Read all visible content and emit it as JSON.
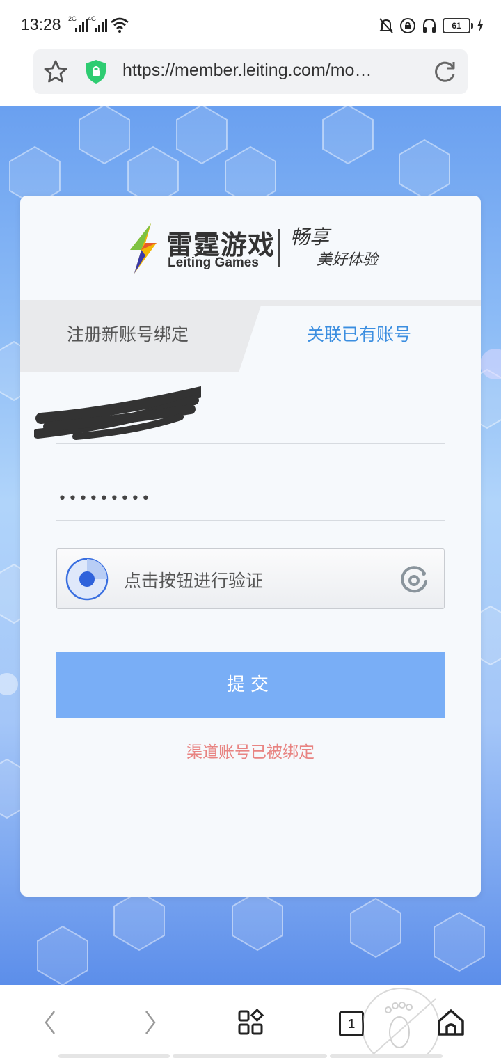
{
  "status_bar": {
    "time": "13:28",
    "signal_1_label": "2G",
    "signal_2_label": "4G",
    "battery_level": "61",
    "icons": [
      "signal-icon",
      "signal-icon",
      "wifi-icon",
      "bell-off-icon",
      "lock-rotation-icon",
      "headphones-icon",
      "battery-icon",
      "charging-icon"
    ]
  },
  "url_bar": {
    "url": "https://member.leiting.com/mo…"
  },
  "logo": {
    "brand_cn": "雷霆游戏",
    "brand_en": "Leiting Games",
    "slogan_line1": "畅享",
    "slogan_line2": "美好体验"
  },
  "tabs": [
    {
      "label": "注册新账号绑定",
      "active": false
    },
    {
      "label": "关联已有账号",
      "active": true
    }
  ],
  "form": {
    "username_value": "",
    "password_value": "•••••••••",
    "captcha_prompt": "点击按钮进行验证",
    "submit_label": "提交",
    "error_message": "渠道账号已被绑定"
  },
  "bottom_nav": {
    "tab_count": "1",
    "icons": [
      "back-icon",
      "forward-icon",
      "apps-icon",
      "tabs-icon",
      "home-icon",
      "footprint-icon"
    ]
  },
  "colors": {
    "accent_tab": "#3b8ee0",
    "submit_button": "#79aef6",
    "error_text": "#e88482",
    "background_blue": "#8dbcf6"
  }
}
